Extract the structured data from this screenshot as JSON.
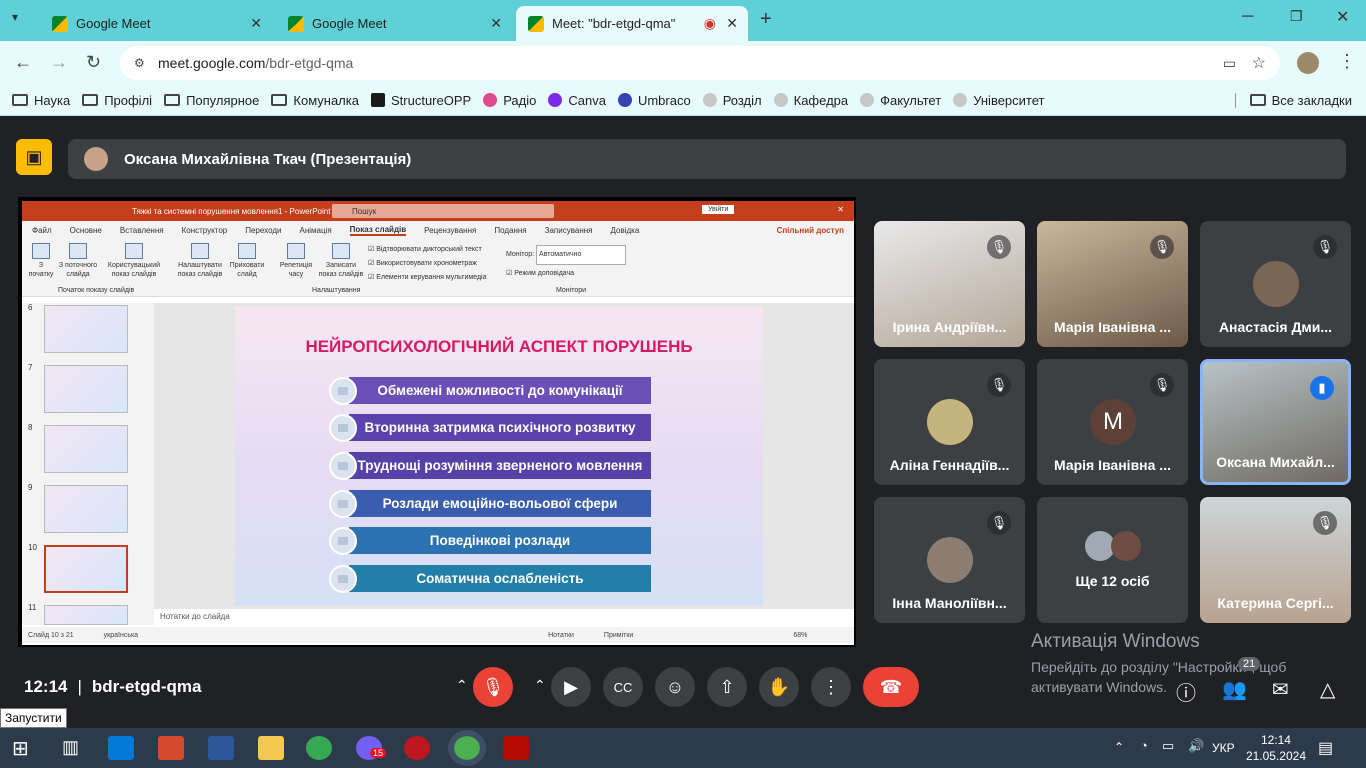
{
  "browser": {
    "tabs": [
      {
        "label": "Google Meet"
      },
      {
        "label": "Google Meet"
      },
      {
        "label": "Meet: \"bdr-etgd-qma\""
      }
    ],
    "url_host": "meet.google.com",
    "url_path": "/bdr-etgd-qma",
    "bookmarks": [
      "Наука",
      "Профілі",
      "Популярное",
      "Комуналка",
      "StructureOPP",
      "Радіо",
      "Canva",
      "Umbraco",
      "Розділ",
      "Кафедра",
      "Факультет",
      "Університет"
    ],
    "all_bookmarks": "Все закладки"
  },
  "meet": {
    "presenter": "Оксана Михайлівна Ткач (Презентація)",
    "time": "12:14",
    "meeting_code": "bdr-etgd-qma",
    "participants_count": "21",
    "activation_title": "Активація Windows",
    "activation_text": "Перейдіть до розділу \"Настройки\", щоб активувати Windows.",
    "tiles": [
      {
        "name": "Ірина Андріївн..."
      },
      {
        "name": "Марія Іванівна ..."
      },
      {
        "name": "Анастасія Дми..."
      },
      {
        "name": "Аліна Геннадіїв..."
      },
      {
        "name": "Марія Іванівна ...",
        "initial": "M"
      },
      {
        "name": "Оксана Михайл..."
      },
      {
        "name": "Інна Маноліївн..."
      },
      {
        "name": "Ще 12 осіб"
      },
      {
        "name": "Катерина Сергі..."
      }
    ]
  },
  "ppt": {
    "window_title": "Тяжкі та системні порушення мовлення1 - PowerPoint",
    "search": "Пошук",
    "signin": "Увійти",
    "menu": [
      "Файл",
      "Основне",
      "Вставлення",
      "Конструктор",
      "Переходи",
      "Анімація",
      "Показ слайдів",
      "Рецензування",
      "Подання",
      "Записування",
      "Довідка"
    ],
    "share": "Спільний доступ",
    "ribbon": {
      "from_start": "З початку",
      "from_current": "З поточного слайда",
      "custom": "Користувацький показ слайдів",
      "setup": "Налаштувати показ слайдів",
      "hide": "Приховати слайд",
      "rehearse": "Репетиція часу",
      "record": "Записати показ слайдів",
      "opt1": "Відтворювати дикторський текст",
      "opt2": "Використовувати хронометраж",
      "opt3": "Елементи керування мультимедіа",
      "monitor_label": "Монітор:",
      "monitor_value": "Автоматично",
      "presenter_mode": "Режим доповідача",
      "group1": "Початок показу слайдів",
      "group2": "Налаштування",
      "group3": "Монітори"
    },
    "thumb_numbers": [
      "6",
      "7",
      "8",
      "9",
      "10",
      "11"
    ],
    "slide_title": "НЕЙРОПСИХОЛОГІЧНИЙ АСПЕКТ ПОРУШЕНЬ",
    "slide_items": [
      "Обмежені можливості до комунікації",
      "Вторинна затримка психічного розвитку",
      "Труднощі розуміння зверненого мовлення",
      "Розлади емоційно-вольової сфери",
      "Поведінкові розлади",
      "Соматична ослабленість"
    ],
    "notes": "Нотатки до слайда",
    "status_slide": "Слайд 10 з 21",
    "status_lang": "українська",
    "status_notes": "Нотатки",
    "status_comments": "Примітки",
    "zoom": "68%"
  },
  "tooltip": "Запустити",
  "taskbar": {
    "lang": "УКР",
    "time": "12:14",
    "date": "21.05.2024",
    "badge": "15"
  },
  "colors": {
    "slide_bars": [
      "#6b4fb8",
      "#5b43ad",
      "#5541a8",
      "#3a5db0",
      "#2c71b0",
      "#237fa8"
    ]
  }
}
